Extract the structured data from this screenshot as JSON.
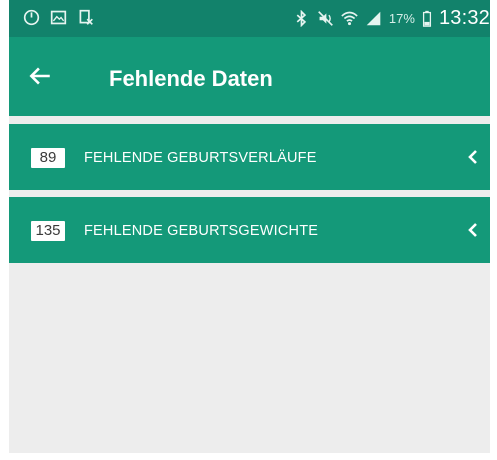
{
  "status_bar": {
    "left_icons": [
      "power-icon",
      "image-icon",
      "document-icon"
    ],
    "right_icons": [
      "bluetooth-icon",
      "mute-icon",
      "wifi-icon",
      "signal-icon",
      "battery-icon"
    ],
    "battery_percent": "17%",
    "time": "13:32"
  },
  "app_bar": {
    "title": "Fehlende Daten",
    "back_icon": "arrow-left-icon"
  },
  "rows": [
    {
      "count": "89",
      "label": "FEHLENDE GEBURTSVERLÄUFE"
    },
    {
      "count": "135",
      "label": "FEHLENDE GEBURTSGEWICHTE"
    }
  ],
  "colors": {
    "status_bar": "#12826b",
    "primary": "#149979",
    "background": "#ededed"
  }
}
